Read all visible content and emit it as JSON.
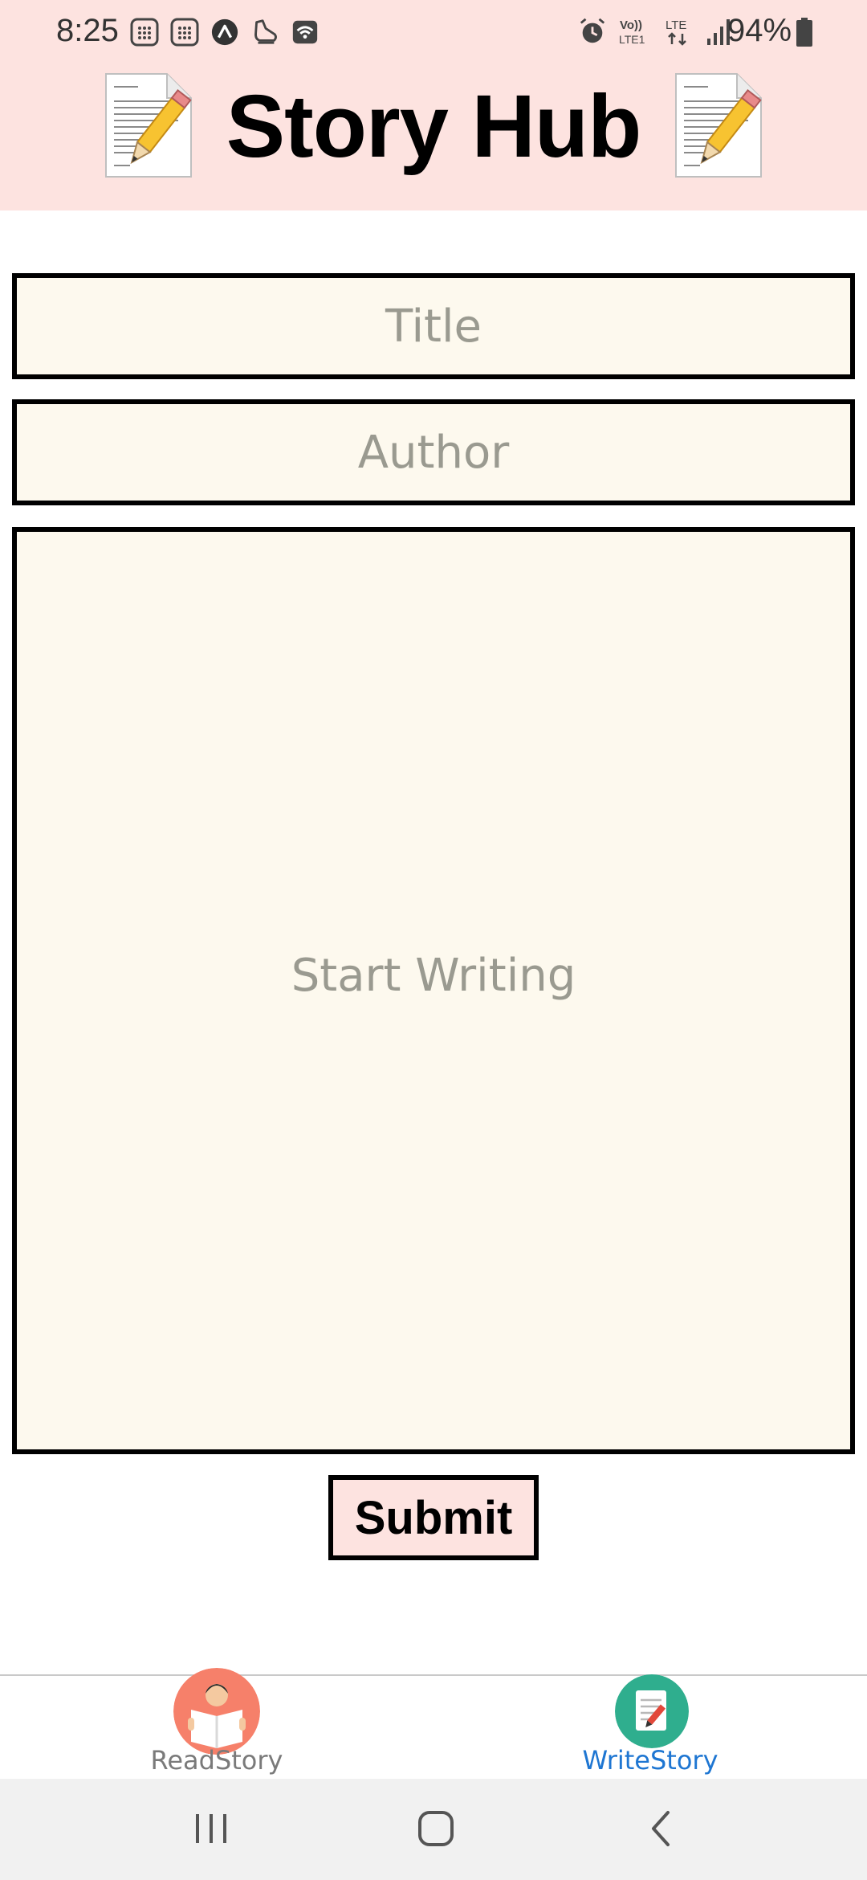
{
  "status_bar": {
    "time": "8:25",
    "battery": "94%",
    "left_icons": [
      "calculator-icon",
      "calculator-icon",
      "ar-icon",
      "shoe-icon",
      "wifi-call-icon"
    ],
    "right_icons": [
      "alarm-icon",
      "volte-icon",
      "lte-icon",
      "signal-icon"
    ]
  },
  "header": {
    "title": "Story Hub",
    "background": "#fde3e0",
    "icon": "document-pencil-icon"
  },
  "form": {
    "title_placeholder": "Title",
    "author_placeholder": "Author",
    "story_placeholder": "Start Writing",
    "submit_label": "Submit",
    "field_background": "#fdf9ee"
  },
  "tabs": [
    {
      "label": "ReadStory",
      "icon": "reading-person-icon",
      "active": false
    },
    {
      "label": "WriteStory",
      "icon": "writing-notepad-icon",
      "active": true
    }
  ],
  "accent": "#1e76d2",
  "system_nav": [
    "recents-button",
    "home-button",
    "back-button"
  ]
}
